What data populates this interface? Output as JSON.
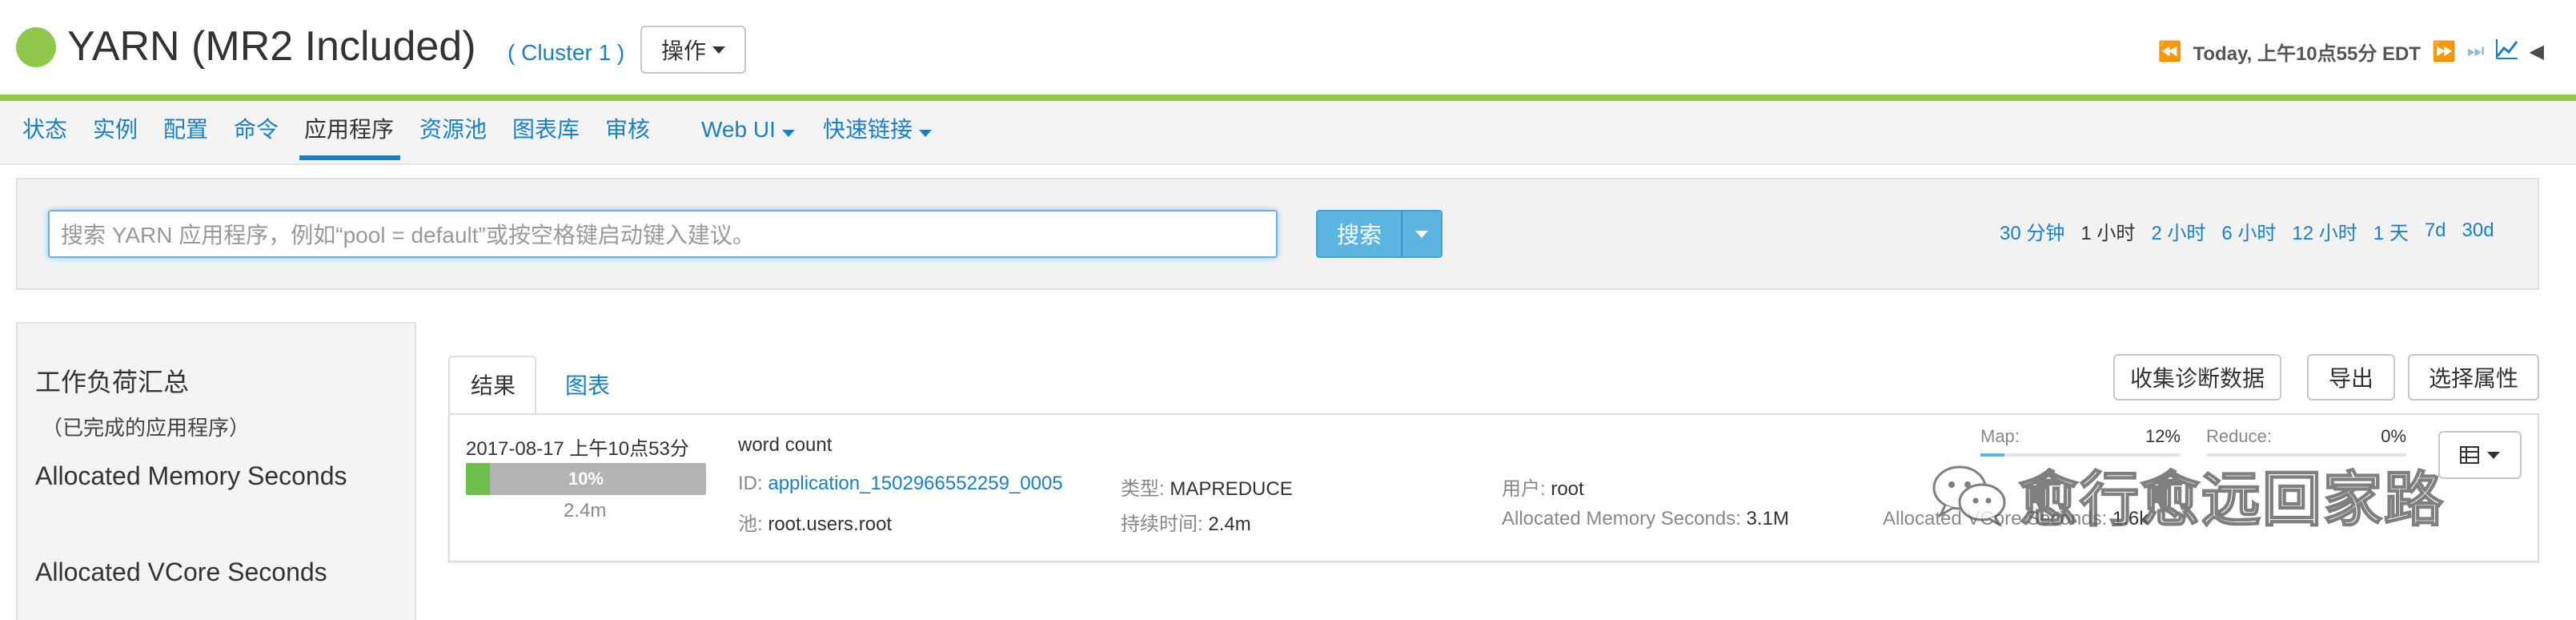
{
  "header": {
    "status_color": "#8fc84a",
    "service_title": "YARN (MR2 Included)",
    "cluster_label": "( Cluster 1 )",
    "actions_label": "操作",
    "time_label": "Today, 上午10点55分 EDT",
    "icons": [
      "rewind-icon",
      "fast-forward-icon",
      "skip-to-end-icon",
      "chart-icon",
      "collapse-icon"
    ]
  },
  "nav": {
    "items": [
      {
        "label": "状态"
      },
      {
        "label": "实例"
      },
      {
        "label": "配置"
      },
      {
        "label": "命令"
      },
      {
        "label": "应用程序"
      },
      {
        "label": "资源池"
      },
      {
        "label": "图表库"
      },
      {
        "label": "审核"
      },
      {
        "label": "Web UI"
      },
      {
        "label": "快速链接"
      }
    ],
    "active_index": 4
  },
  "search": {
    "placeholder": "搜索 YARN 应用程序，例如“pool = default”或按空格键启动键入建议。",
    "button_label": "搜索",
    "ranges": [
      "30 分钟",
      "1 小时",
      "2 小时",
      "6 小时",
      "12 小时",
      "1 天",
      "7d",
      "30d"
    ],
    "active_range": "1 小时"
  },
  "summary": {
    "title": "工作负荷汇总",
    "subtitle": "（已完成的应用程序）",
    "items": [
      "Allocated Memory Seconds",
      "Allocated VCore Seconds"
    ]
  },
  "results": {
    "tabs": [
      "结果",
      "图表"
    ],
    "active_tab": "结果",
    "buttons": {
      "collect": "收集诊断数据",
      "export": "导出",
      "select_attrs": "选择属性"
    },
    "app": {
      "date": "2017-08-17 上午10点53分",
      "progress_percent": 10,
      "progress_label": "10%",
      "duration_short": "2.4m",
      "name": "word count",
      "id_label": "ID:",
      "id_value": "application_1502966552259_0005",
      "pool_label": "池:",
      "pool_value": "root.users.root",
      "type_label": "类型:",
      "type_value": "MAPREDUCE",
      "duration_label": "持续时间:",
      "duration_value": "2.4m",
      "user_label": "用户:",
      "user_value": "root",
      "mem_label": "Allocated Memory Seconds:",
      "mem_value": "3.1M",
      "vcore_label": "Allocated VCore Seconds:",
      "vcore_value": "1.6k",
      "map_label": "Map:",
      "map_value": "12%",
      "map_percent": 12,
      "reduce_label": "Reduce:",
      "reduce_value": "0%",
      "reduce_percent": 0
    }
  },
  "watermark": {
    "text": "愈行愈远回家路"
  }
}
